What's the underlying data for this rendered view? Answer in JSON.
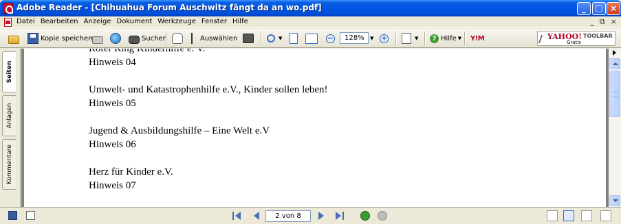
{
  "window": {
    "title": "Adobe Reader - [Chihuahua Forum Auschwitz fängt da an wo.pdf]",
    "min_label": "_",
    "max_label": "□",
    "close_label": "×"
  },
  "menubar": {
    "items": [
      "Datei",
      "Bearbeiten",
      "Anzeige",
      "Dokument",
      "Werkzeuge",
      "Fenster",
      "Hilfe"
    ],
    "mdi": [
      "_",
      "⧉",
      "×"
    ]
  },
  "toolbar": {
    "save_copy_label": "Kopie speichern",
    "search_label": "Suchen",
    "select_label": "Auswählen",
    "zoom_value": "128%",
    "zoom_out_label": "−",
    "zoom_in_label": "+",
    "help_label": "Hilfe",
    "ym_label": "Y!M",
    "yahoo_brand": "YAHOO!",
    "yahoo_toolbar": "TOOLBAR",
    "yahoo_gratis": "Gratis"
  },
  "navpane": {
    "tabs": [
      "Seiten",
      "Anlagen",
      "Kommentare"
    ]
  },
  "document": {
    "lines": [
      "Roter Ring Kinderhilfe e. V.",
      "Hinweis 04",
      "",
      "Umwelt- und Katastrophenhilfe e.V., Kinder sollen leben!",
      "Hinweis 05",
      "",
      "Jugend & Ausbildungshilfe – Eine Welt e.V",
      "Hinweis 06",
      "",
      "Herz für Kinder e.V.",
      "Hinweis 07"
    ]
  },
  "statusbar": {
    "page_indicator": "2 von 8"
  }
}
